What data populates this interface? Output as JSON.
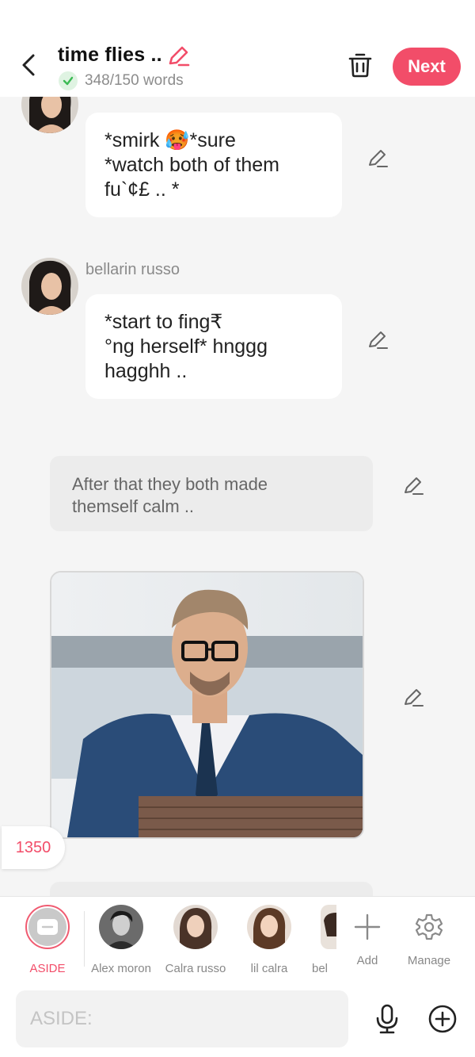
{
  "header": {
    "title": "time flies ..",
    "word_count": "348/150 words",
    "next_label": "Next",
    "accent_color": "#f24d69"
  },
  "messages": [
    {
      "speaker": "",
      "text": "*smirk 🥵*sure\n*watch both of them\nfu`¢£ .. *"
    },
    {
      "speaker": "bellarin russo",
      "text": "*start to fing₹\n°ng  herself* hnggg\nhagghh .."
    }
  ],
  "narration": {
    "text": "After that they both made\nthemself calm .."
  },
  "counter": "1350",
  "characters": [
    {
      "label": "ASIDE"
    },
    {
      "label": "Alex moron"
    },
    {
      "label": "Calra  russo"
    },
    {
      "label": "lil calra"
    },
    {
      "label": "bel"
    }
  ],
  "actions": {
    "add_label": "Add",
    "manage_label": "Manage"
  },
  "input": {
    "placeholder": "ASIDE:"
  }
}
